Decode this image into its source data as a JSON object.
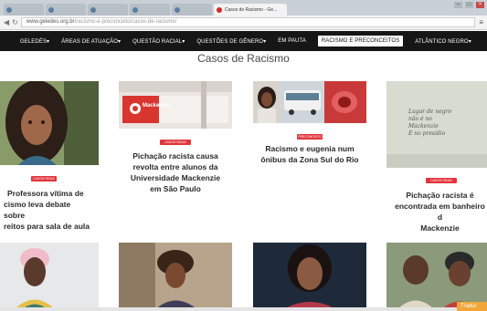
{
  "browser": {
    "tabs": [
      {
        "label": ""
      },
      {
        "label": ""
      },
      {
        "label": ""
      },
      {
        "label": ""
      },
      {
        "label": ""
      },
      {
        "label": "Casos de Racismo - Ge..."
      }
    ],
    "url_host": "www.geledes.org.br",
    "url_path": "/racismo-e-preconceito/casos-de-racismo/"
  },
  "nav": {
    "items": [
      "GELEDÉS▾",
      "ÁREAS DE ATUAÇÃO▾",
      "QUESTÃO RACIAL▾",
      "QUESTÕES DE GÊNERO▾",
      "EM PAUTA",
      "RACISMO E PRECONCEITOS",
      "ATLÂNTICO NEGRO▾"
    ]
  },
  "page": {
    "title": "Casos de Racismo"
  },
  "cards": [
    {
      "tag": "CASOS REAIS",
      "lines": [
        "Professora vítima de",
        "cismo leva debate sobre",
        "reitos para sala de aula"
      ]
    },
    {
      "tag": "CASOS REAIS",
      "lines": [
        "Pichação racista causa",
        "revolta entre alunos da",
        "Universidade Mackenzie",
        "em São Paulo"
      ]
    },
    {
      "tag": "PRECONCEITO",
      "lines": [
        "Racismo e eugenia num",
        "ônibus da Zona Sul do Rio"
      ]
    },
    {
      "tag": "CASOS REAIS",
      "lines": [
        "Pichação racista é",
        "encontrada em banheiro d",
        "Mackenzie"
      ]
    }
  ],
  "photos": {
    "mackenzie_sign": "Mackenzie",
    "graffiti_text": [
      "Lugar de negro",
      "não é no",
      "Mackenzie",
      "E no presídio"
    ]
  },
  "toast": {
    "label": "Tradut"
  },
  "colors": {
    "accent": "#e2353b",
    "nav_bg": "#161616"
  }
}
